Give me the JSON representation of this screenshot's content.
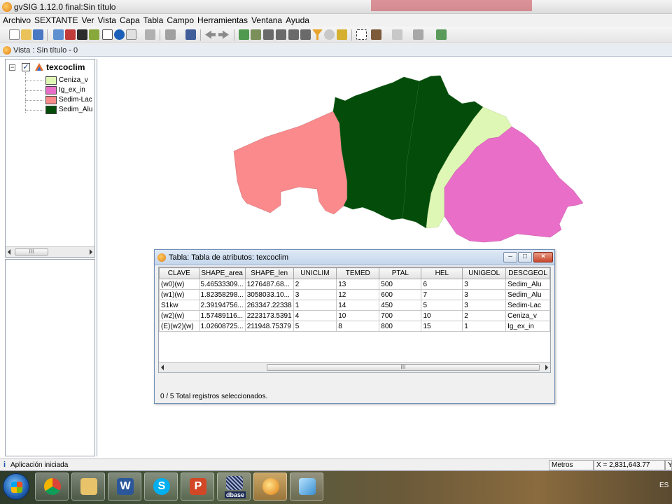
{
  "window": {
    "title": "gvSIG 1.12.0 final:Sin título"
  },
  "menu": [
    "Archivo",
    "SEXTANTE",
    "Ver",
    "Vista",
    "Capa",
    "Tabla",
    "Campo",
    "Herramientas",
    "Ventana",
    "Ayuda"
  ],
  "view": {
    "title": "Vista : Sin título - 0"
  },
  "toc": {
    "layer_name": "texcoclim",
    "checked": true,
    "legend": [
      {
        "label": "Ceniza_v",
        "color": "#dff7b4"
      },
      {
        "label": "Ig_ex_in",
        "color": "#e96ec8"
      },
      {
        "label": "Sedim-Lac",
        "color": "#fa8a8c"
      },
      {
        "label": "Sedim_Alu",
        "color": "#034c0a"
      }
    ]
  },
  "map_colors": {
    "sedim_lac": "#fa8a8c",
    "sedim_alu": "#034c0a",
    "ceniza_v": "#dff7b4",
    "ig_ex_in": "#e96ec8"
  },
  "attribute_table": {
    "title": "Tabla: Tabla de atributos: texcoclim",
    "columns": [
      "CLAVE",
      "SHAPE_area",
      "SHAPE_len",
      "UNICLIM",
      "TEMED",
      "PTAL",
      "HEL",
      "UNIGEOL",
      "DESCGEOL"
    ],
    "rows": [
      [
        "(w0)(w)",
        "5.46533309...",
        "1276487.68...",
        "2",
        "13",
        "500",
        "6",
        "3",
        "Sedim_Alu"
      ],
      [
        "(w1)(w)",
        "1.82358298...",
        "3058033.10...",
        "3",
        "12",
        "600",
        "7",
        "3",
        "Sedim_Alu"
      ],
      [
        "S1kw",
        "2.39194756...",
        "263347.22338",
        "1",
        "14",
        "450",
        "5",
        "3",
        "Sedim-Lac"
      ],
      [
        "(w2)(w)",
        "1.57489116...",
        "2223173.5391",
        "4",
        "10",
        "700",
        "10",
        "2",
        "Ceniza_v"
      ],
      [
        "(E)(w2)(w)",
        "1.02608725...",
        "211948.75379",
        "5",
        "8",
        "800",
        "15",
        "1",
        "Ig_ex_in"
      ]
    ],
    "status": "0 / 5 Total registros seleccionados."
  },
  "statusbar": {
    "message": "Aplicación iniciada",
    "units": "Metros",
    "x_coord": "X = 2,831,643.77",
    "y_coord": "Y"
  },
  "taskbar": {
    "apps": [
      "start",
      "chrome",
      "explorer",
      "word",
      "skype",
      "powerpoint",
      "dbase",
      "gvsig",
      "other"
    ],
    "dbase_label": "dbase",
    "language": "ES"
  }
}
